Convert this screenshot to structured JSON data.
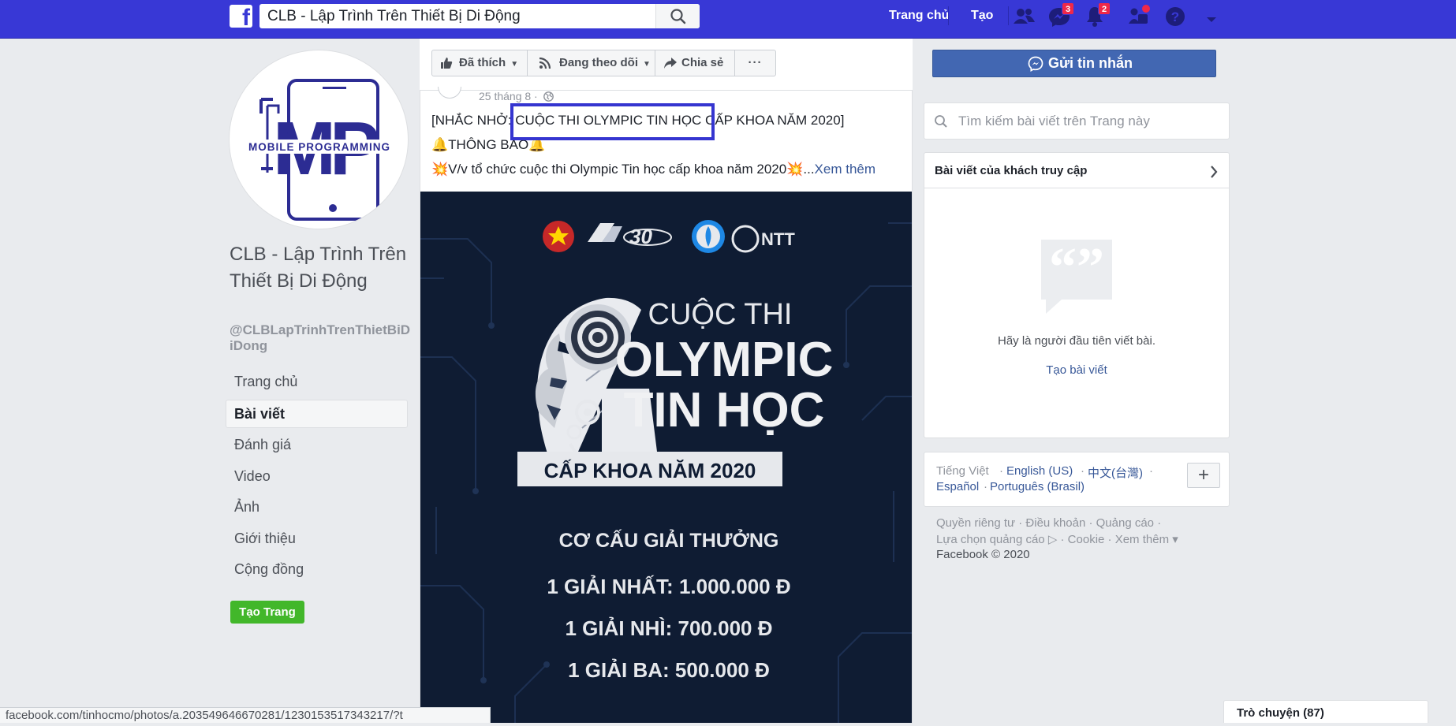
{
  "topbar": {
    "logo_letter": "f",
    "search_value": "CLB - Lập Trình Trên Thiết Bị Di Động",
    "nav_home": "Trang chủ",
    "nav_create": "Tạo",
    "messenger_badge": "3",
    "notifications_badge": "2",
    "accent_color": "#3838d6"
  },
  "left": {
    "logo_text": "MOBILE PROGRAMMING",
    "logo_letters": "MP",
    "page_name": "CLB - Lập Trình Trên Thiết Bị Di Động",
    "page_handle": "@CLBLapTrinhTrenThietBiDiDong",
    "nav": [
      "Trang chủ",
      "Bài viết",
      "Đánh giá",
      "Video",
      "Ảnh",
      "Giới thiệu",
      "Cộng đồng"
    ],
    "active_index": 1,
    "create_page": "Tạo Trang"
  },
  "actions": {
    "liked": "Đã thích",
    "following": "Đang theo dõi",
    "share": "Chia sẻ",
    "more": "···",
    "message": "Gửi tin nhắn"
  },
  "post": {
    "date": "25 tháng 8 ·",
    "line1": "[NHẮC NHỞ: CUỘC THI OLYMPIC TIN HỌC CẤP KHOA NĂM 2020]",
    "line2": "🔔THÔNG BÁO🔔",
    "line3": "💥V/v tổ chức cuộc thi Olympic Tin học cấp khoa năm 2020💥...",
    "see_more": "Xem thêm"
  },
  "poster": {
    "title_small": "CUỘC THI",
    "title_big1": "OLYMPIC",
    "title_big2": "TIN HỌC",
    "band": "CẤP KHOA NĂM 2020",
    "prize_heading": "CƠ CẤU GIẢI THƯỞNG",
    "prize1": "1 GIẢI NHẤT: 1.000.000 Đ",
    "prize2": "1 GIẢI NHÌ: 700.000 Đ",
    "prize3": "1 GIẢI BA: 500.000 Đ",
    "logo_ntt": "NTT",
    "logo_30": "30"
  },
  "right": {
    "search_placeholder": "Tìm kiếm bài viết trên Trang này",
    "visitor_title": "Bài viết của khách truy cập",
    "visitor_empty": "Hãy là người đầu tiên viết bài.",
    "visitor_create": "Tạo bài viết",
    "lang_current": "Tiếng Việt",
    "lang_en": "English (US)",
    "lang_zh": "中文(台灣)",
    "lang_es": "Español",
    "lang_pt": "Português (Brasil)",
    "footer_line1": "Quyền riêng tư · Điều khoản · Quảng cáo ·",
    "footer_line2": "Lựa chọn quảng cáo ▷ · Cookie · Xem thêm ▾",
    "footer_line3": "Facebook © 2020"
  },
  "status_url": "facebook.com/tinhocmo/photos/a.203549646670281/1230153517343217/?t",
  "chat_label": "Trò chuyện (87)"
}
